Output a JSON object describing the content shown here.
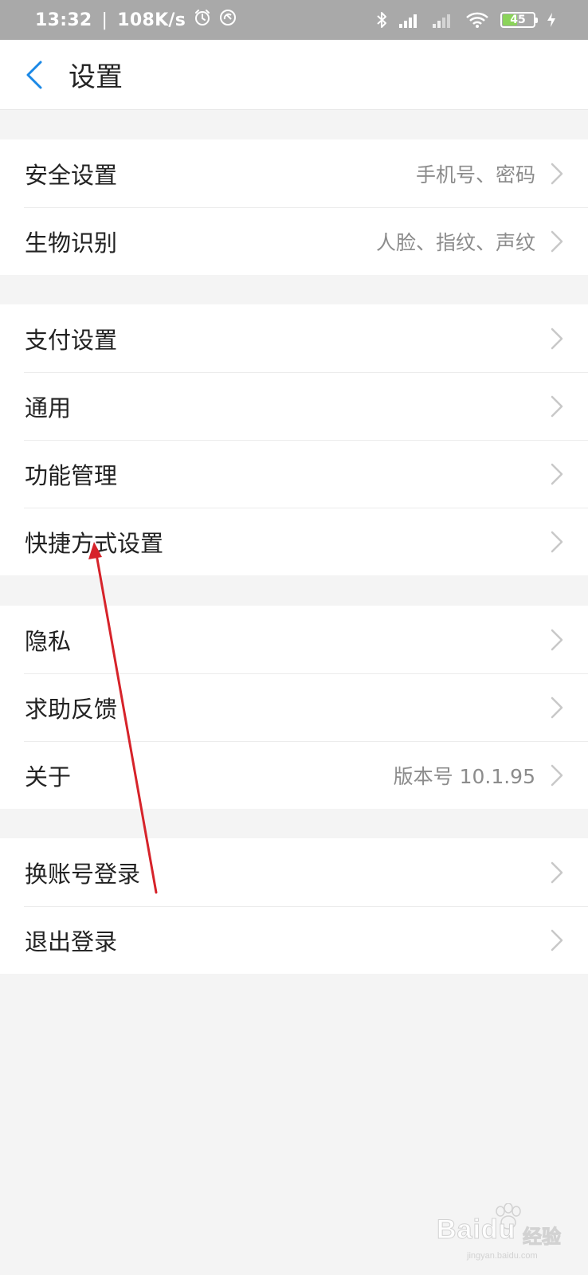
{
  "status_bar": {
    "time": "13:32",
    "network_speed": "108K/s",
    "battery_level": "45"
  },
  "header": {
    "title": "设置"
  },
  "groups": [
    {
      "items": [
        {
          "label": "安全设置",
          "value": "手机号、密码"
        },
        {
          "label": "生物识别",
          "value": "人脸、指纹、声纹"
        }
      ]
    },
    {
      "items": [
        {
          "label": "支付设置",
          "value": ""
        },
        {
          "label": "通用",
          "value": ""
        },
        {
          "label": "功能管理",
          "value": ""
        },
        {
          "label": "快捷方式设置",
          "value": ""
        }
      ]
    },
    {
      "items": [
        {
          "label": "隐私",
          "value": ""
        },
        {
          "label": "求助反馈",
          "value": ""
        },
        {
          "label": "关于",
          "value": "版本号 10.1.95"
        }
      ]
    },
    {
      "items": [
        {
          "label": "换账号登录",
          "value": ""
        },
        {
          "label": "退出登录",
          "value": ""
        }
      ]
    }
  ],
  "watermark": {
    "brand": "Bai",
    "brand_tail": "du",
    "suffix": "经验",
    "url": "jingyan.baidu.com"
  },
  "colors": {
    "accent": "#1a88e6",
    "annotation_arrow": "#d6232a",
    "status_bar_bg": "#a9a9a9",
    "page_bg": "#f4f4f4",
    "value_text": "#8c8c8c"
  }
}
